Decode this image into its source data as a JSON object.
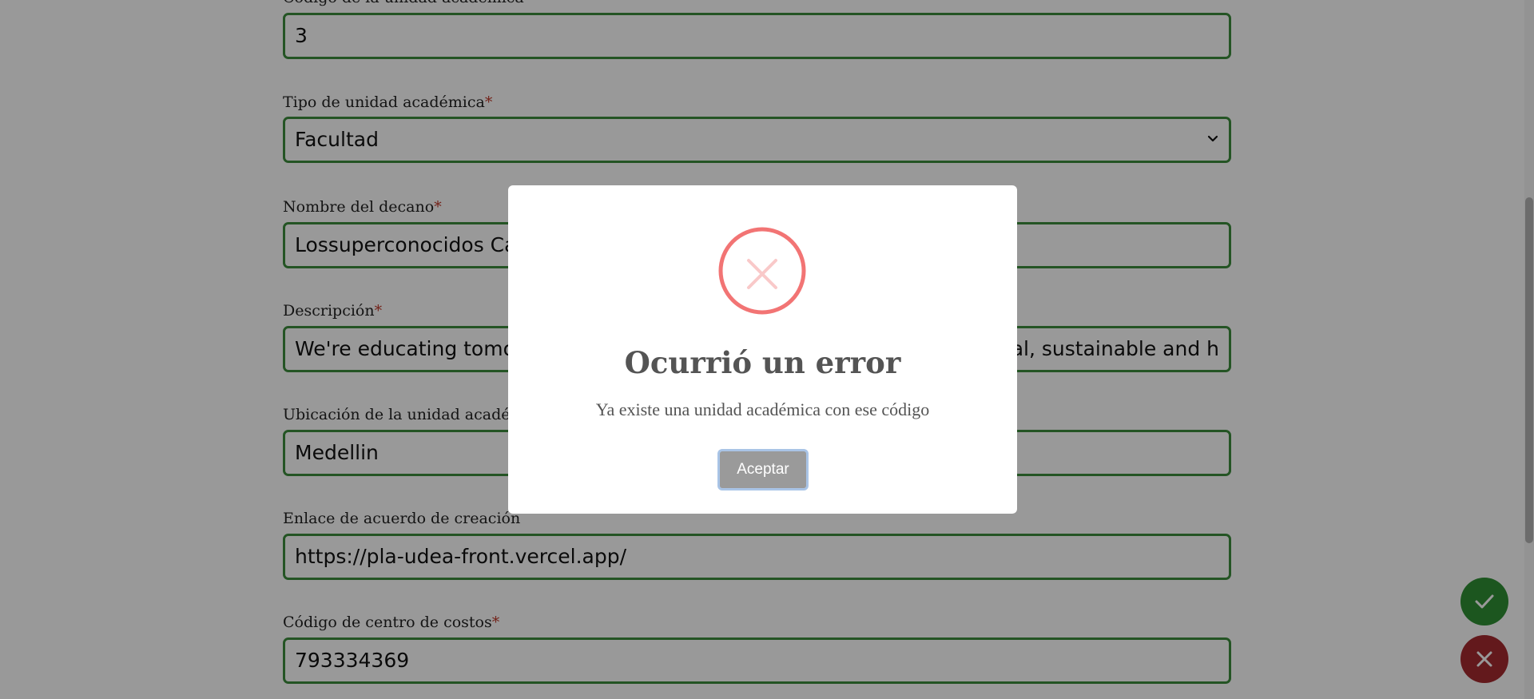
{
  "form": {
    "fields": [
      {
        "label": "Código de la unidad académica",
        "required": true,
        "value": "3"
      },
      {
        "label": "Tipo de unidad académica",
        "required": true,
        "value": "Facultad"
      },
      {
        "label": "Nombre del decano",
        "required": true,
        "value": "Lossuperconocidos Cal"
      },
      {
        "label": "Descripción",
        "required": true,
        "value": "We're educating tomor",
        "value_tail": "ital, sustainable and h"
      },
      {
        "label": "Ubicación de la unidad académ",
        "required": false,
        "value": "Medellin"
      },
      {
        "label": "Enlace de acuerdo de creación",
        "required": false,
        "value": "https://pla-udea-front.vercel.app/"
      },
      {
        "label": "Código de centro de costos",
        "required": true,
        "value": "793334369"
      }
    ],
    "required_marker": "*"
  },
  "modal": {
    "icon": "error-x-icon",
    "title": "Ocurrió un error",
    "message": "Ya existe una unidad académica con ese código",
    "accept_label": "Aceptar"
  },
  "fabs": {
    "confirm_icon": "check-icon",
    "cancel_icon": "close-icon"
  },
  "colors": {
    "field_border": "#3c8d3c",
    "required_marker": "#c0392b",
    "error_icon": "#f27474",
    "confirm_fab": "#2f8f35",
    "cancel_fab": "#a52a2f",
    "modal_button": "#9a9a9a"
  }
}
